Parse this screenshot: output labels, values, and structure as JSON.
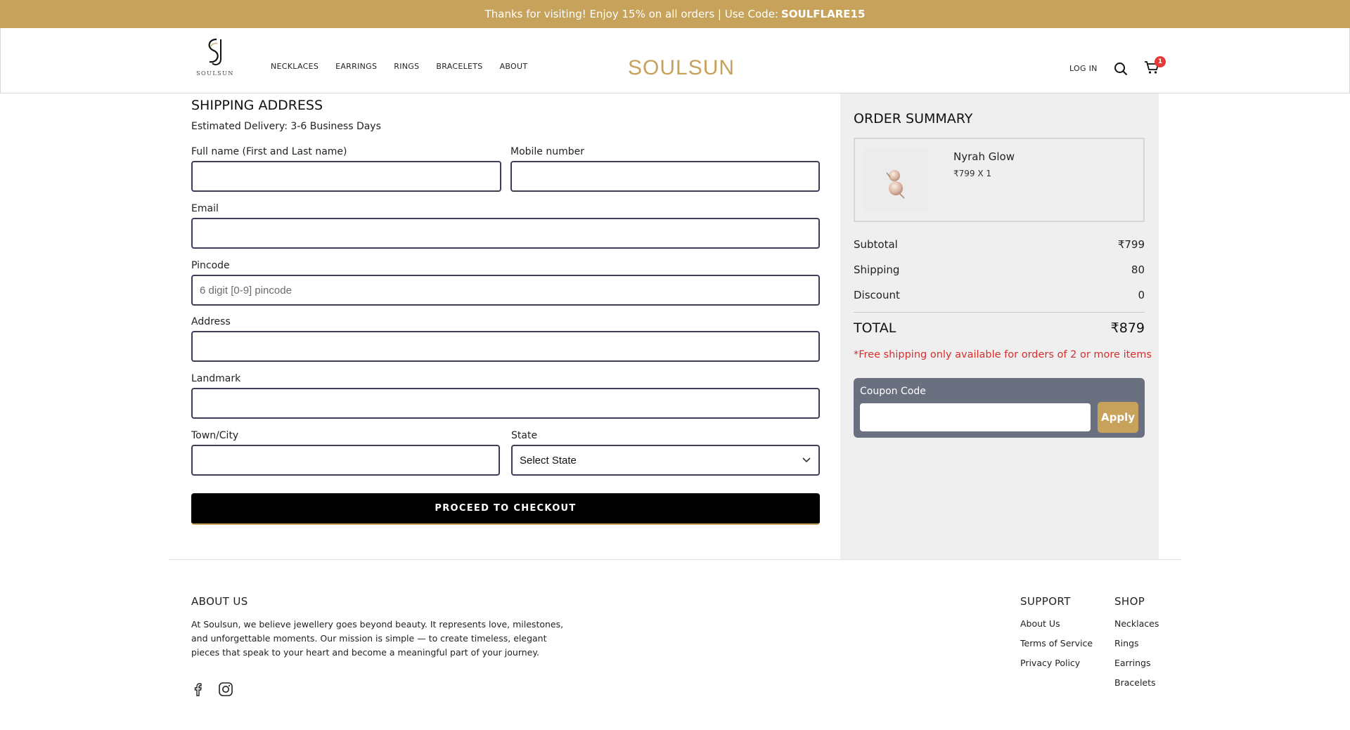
{
  "promo": {
    "text": "Thanks for visiting! Enjoy 15% on all orders | Use Code:",
    "code": "SOULFLARE15"
  },
  "header": {
    "logo_text": "SOULSUN",
    "brand": "SOULSUN",
    "nav": [
      "NECKLACES",
      "EARRINGS",
      "RINGS",
      "BRACELETS",
      "ABOUT"
    ],
    "login": "LOG IN",
    "cart_count": "1"
  },
  "shipping": {
    "title": "SHIPPING ADDRESS",
    "estimate": "Estimated Delivery: 3-6 Business Days",
    "fullname_label": "Full name (First and Last name)",
    "mobile_label": "Mobile number",
    "email_label": "Email",
    "pincode_label": "Pincode",
    "pincode_placeholder": "6 digit [0-9] pincode",
    "address_label": "Address",
    "landmark_label": "Landmark",
    "city_label": "Town/City",
    "state_label": "State",
    "state_value": "Select State",
    "checkout_button": "PROCEED TO CHECKOUT"
  },
  "summary": {
    "title": "ORDER SUMMARY",
    "item_name": "Nyrah Glow",
    "item_price": "₹799 X 1",
    "subtotal_label": "Subtotal",
    "subtotal_value": "₹799",
    "shipping_label": "Shipping",
    "shipping_value": "80",
    "discount_label": "Discount",
    "discount_value": "0",
    "total_label": "TOTAL",
    "total_value": "₹879",
    "note": "*Free shipping only available for orders of 2 or more items",
    "coupon_label": "Coupon Code",
    "coupon_button": "Apply"
  },
  "footer": {
    "about_title": "ABOUT US",
    "about_text": "At Soulsun, we believe jewellery goes beyond beauty. It represents love, milestones, and unforgettable moments. Our mission is simple — to create timeless, elegant pieces that speak to your heart and become a meaningful part of your journey.",
    "support_title": "SUPPORT",
    "support_links": [
      "About Us",
      "Terms of Service",
      "Privacy Policy"
    ],
    "shop_title": "SHOP",
    "shop_links": [
      "Necklaces",
      "Rings",
      "Earrings",
      "Bracelets"
    ]
  },
  "colors": {
    "accent": "#c6a25b",
    "coupon_bg": "#6b7080",
    "note_red": "#d32f2f",
    "summary_bg": "#efefef"
  },
  "icons": [
    "facebook-icon",
    "instagram-icon",
    "search-icon",
    "cart-icon",
    "chevron-down-icon"
  ]
}
